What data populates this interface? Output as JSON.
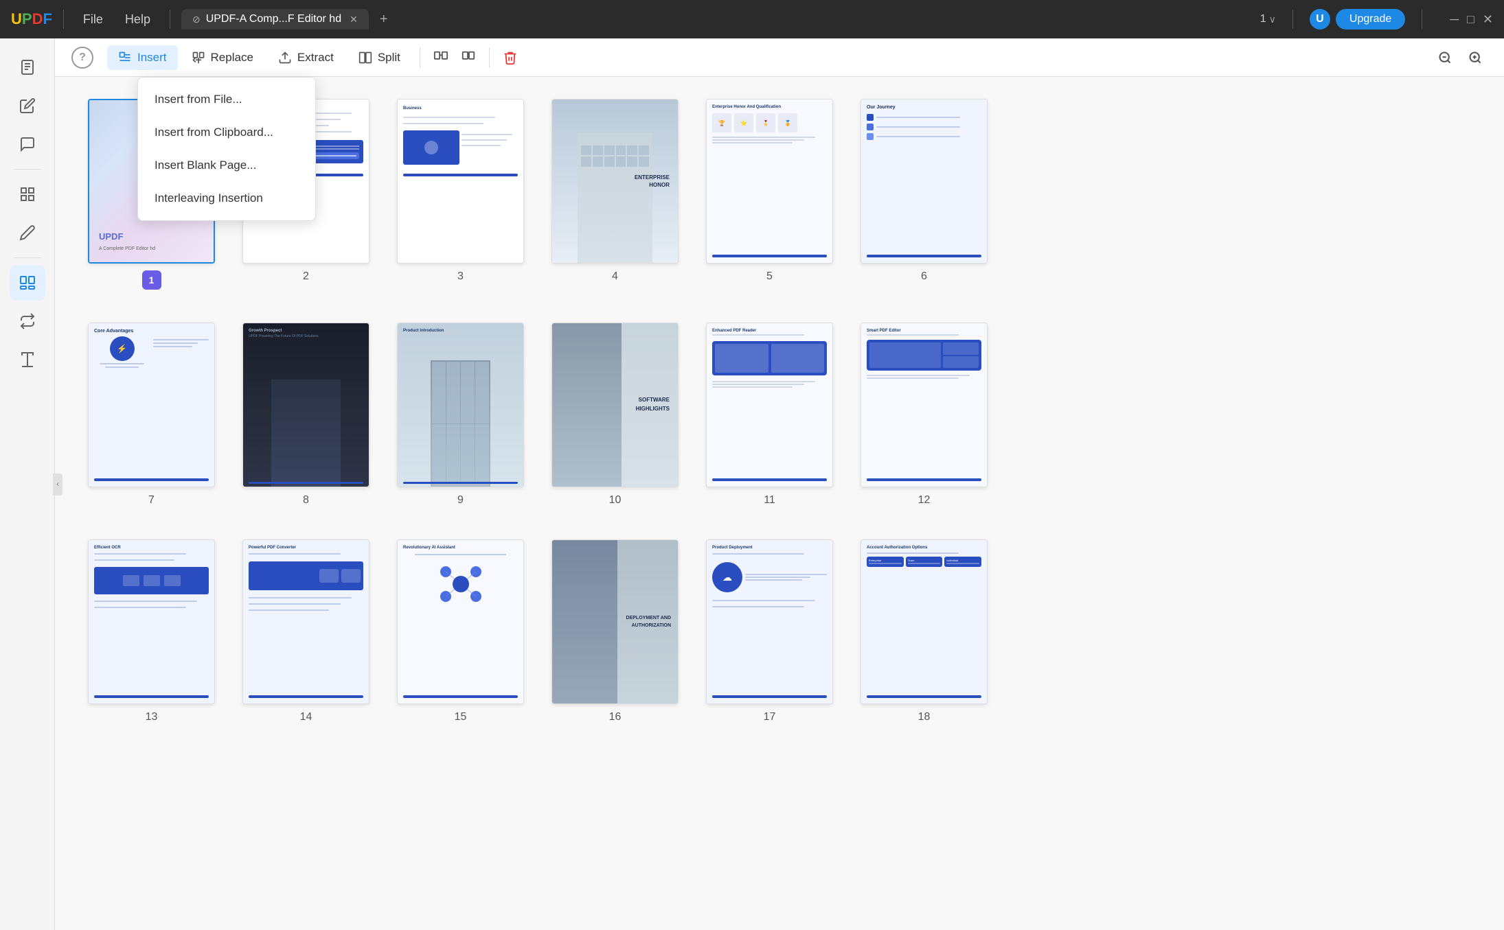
{
  "titlebar": {
    "logo": "UPDF",
    "logo_u": "U",
    "logo_p": "P",
    "logo_d": "D",
    "logo_f": "F",
    "menu_file": "File",
    "menu_help": "Help",
    "tab_label": "UPDF-A Comp...F Editor hd",
    "tab_icon": "⊘",
    "page_count": "1",
    "upgrade_label": "Upgrade",
    "avatar_letter": "U",
    "window_min": "─",
    "window_max": "□",
    "window_close": "✕"
  },
  "toolbar": {
    "help_label": "?",
    "insert_label": "Insert",
    "replace_label": "Replace",
    "extract_label": "Extract",
    "split_label": "Split",
    "zoom_out_label": "−",
    "zoom_in_label": "+"
  },
  "dropdown": {
    "item1": "Insert from File...",
    "item2": "Insert from Clipboard...",
    "item3": "Insert Blank Page...",
    "item4": "Interleaving Insertion"
  },
  "sidebar": {
    "icons": [
      {
        "name": "reader-icon",
        "symbol": "📄"
      },
      {
        "name": "edit-icon",
        "symbol": "✏️"
      },
      {
        "name": "comment-icon",
        "symbol": "💬"
      },
      {
        "name": "organize-icon",
        "symbol": "⊞"
      },
      {
        "name": "sign-icon",
        "symbol": "✒️"
      },
      {
        "name": "pages-icon",
        "symbol": "⊟"
      },
      {
        "name": "convert-icon",
        "symbol": "⇄"
      },
      {
        "name": "tools-icon",
        "symbol": "🔧"
      }
    ]
  },
  "pages": [
    {
      "number": "1",
      "label": "1",
      "selected": true
    },
    {
      "number": "2",
      "label": "2"
    },
    {
      "number": "3",
      "label": "3"
    },
    {
      "number": "4",
      "label": "4"
    },
    {
      "number": "5",
      "label": "5"
    },
    {
      "number": "6",
      "label": "6"
    },
    {
      "number": "7",
      "label": "7"
    },
    {
      "number": "8",
      "label": "8"
    },
    {
      "number": "9",
      "label": "9"
    },
    {
      "number": "10",
      "label": "10"
    },
    {
      "number": "11",
      "label": "11"
    },
    {
      "number": "12",
      "label": "12"
    },
    {
      "number": "13",
      "label": "13"
    },
    {
      "number": "14",
      "label": "14"
    },
    {
      "number": "15",
      "label": "15"
    },
    {
      "number": "16",
      "label": "16"
    },
    {
      "number": "17",
      "label": "17"
    },
    {
      "number": "18",
      "label": "18"
    }
  ],
  "page_labels": {
    "p7": "Core Advantages",
    "p8": "Growth Prospect",
    "p9": "Product Introduction",
    "p10": "SOFTWARE HIGHLIGHTS",
    "p11": "Enhanced PDF Reader",
    "p12": "Smart PDF Editor",
    "p13": "Efficient OCR",
    "p14": "Powerful PDF Converter",
    "p15": "Revolutionary AI Assistant",
    "p16": "DEPLOYMENT AND AUTHORIZATION",
    "p17": "Product Deployment",
    "p18": "Account Authorization Options"
  },
  "colors": {
    "accent": "#1e88e5",
    "purple": "#6b5ce7",
    "toolbar_bg": "#ffffff",
    "sidebar_bg": "#f5f5f5",
    "page_bg": "#f8f8f8"
  }
}
